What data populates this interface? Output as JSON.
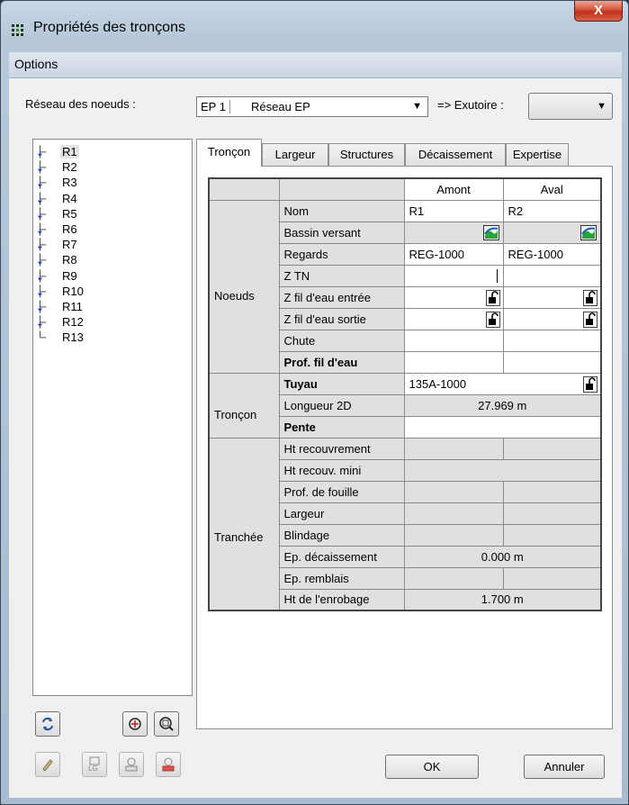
{
  "window": {
    "title": "Propriétés des tronçons",
    "close_label": "X"
  },
  "menu": {
    "options_label": "Options"
  },
  "network": {
    "label": "Réseau des noeuds :",
    "code": "EP 1",
    "name": "Réseau EP",
    "exutoire_label": "=> Exutoire :",
    "exutoire_value": ""
  },
  "tree": {
    "items": [
      "R1",
      "R2",
      "R3",
      "R4",
      "R5",
      "R6",
      "R7",
      "R8",
      "R9",
      "R10",
      "R11",
      "R12",
      "R13"
    ],
    "selected": "R1"
  },
  "tabs": [
    "Tronçon",
    "Largeur",
    "Structures",
    "Décaissement",
    "Expertise"
  ],
  "grid": {
    "col_amont": "Amont",
    "col_aval": "Aval",
    "groups": {
      "noeuds": "Noeuds",
      "troncon": "Tronçon",
      "tranchee": "Tranchée"
    },
    "rows": {
      "nom": {
        "label": "Nom",
        "amont": "R1",
        "aval": "R2"
      },
      "bassin": {
        "label": "Bassin versant"
      },
      "regards": {
        "label": "Regards",
        "amont": "REG-1000",
        "aval": "REG-1000"
      },
      "ztn": {
        "label": "Z TN"
      },
      "zfe_entree": {
        "label": "Z fil d'eau entrée"
      },
      "zfe_sortie": {
        "label": "Z fil d'eau sortie"
      },
      "chute": {
        "label": "Chute"
      },
      "prof_fe": {
        "label": "Prof. fil d'eau"
      },
      "tuyau": {
        "label": "Tuyau",
        "value": "135A-1000"
      },
      "longueur": {
        "label": "Longueur 2D",
        "value": "27.969 m"
      },
      "pente": {
        "label": "Pente"
      },
      "ht_recouv": {
        "label": "Ht recouvrement"
      },
      "ht_recouv_mini": {
        "label": "Ht recouv. mini"
      },
      "prof_fouille": {
        "label": "Prof. de fouille"
      },
      "largeur": {
        "label": "Largeur"
      },
      "blindage": {
        "label": "Blindage"
      },
      "ep_decaiss": {
        "label": "Ep. décaissement",
        "value": "0.000 m"
      },
      "ep_remblais": {
        "label": "Ep. remblais"
      },
      "ht_enrobage": {
        "label": "Ht de l'enrobage",
        "value": "1.700 m"
      }
    }
  },
  "buttons": {
    "ok": "OK",
    "cancel": "Annuler"
  },
  "icons": [
    "app-grid-icon",
    "refresh-icon",
    "zoom-in-icon",
    "zoom-extent-icon",
    "pencil-icon",
    "lg-icon",
    "print-node-icon",
    "print-red-icon",
    "bassin-icon",
    "lock-icon",
    "node-icon"
  ]
}
